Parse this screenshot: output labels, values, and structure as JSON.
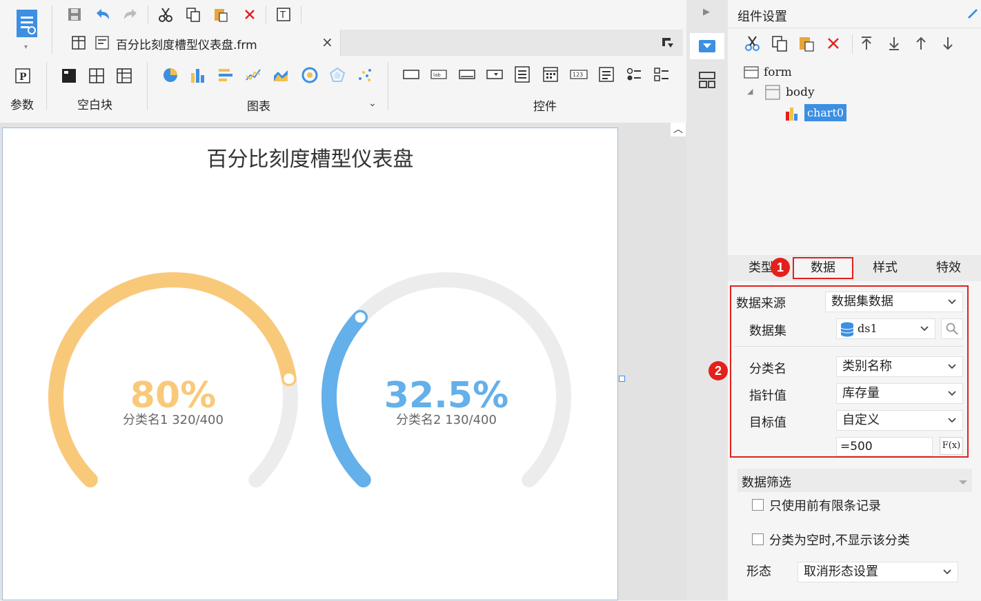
{
  "toolbar": {
    "groups": {
      "param": "参数",
      "blank": "空白块",
      "chart": "图表",
      "widget": "控件"
    }
  },
  "file_tab": {
    "title": "百分比刻度槽型仪表盘.frm",
    "close": "×"
  },
  "chart": {
    "title": "百分比刻度槽型仪表盘"
  },
  "chart_data": [
    {
      "type": "gauge",
      "category": "分类名1",
      "value": 320,
      "max": 400,
      "percent_label": "80%",
      "detail_label": "分类名1 320/400",
      "color": "#f9c97a"
    },
    {
      "type": "gauge",
      "category": "分类名2",
      "value": 130,
      "max": 400,
      "percent_label": "32.5%",
      "detail_label": "分类名2 130/400",
      "color": "#63b0ea"
    }
  ],
  "right_panel": {
    "title": "组件设置",
    "tree": {
      "form": "form",
      "body": "body",
      "chart": "chart0"
    },
    "tabs": [
      "类型",
      "数据",
      "样式",
      "特效"
    ],
    "data_source_label": "数据来源",
    "data_source_value": "数据集数据",
    "dataset_label": "数据集",
    "dataset_value": "ds1",
    "category_label": "分类名",
    "category_value": "类别名称",
    "pointer_label": "指针值",
    "pointer_value": "库存量",
    "target_label": "目标值",
    "target_value": "自定义",
    "target_formula": "=500",
    "fx": "F(x)",
    "filter_title": "数据筛选",
    "checkbox1": "只使用前有限条记录",
    "checkbox2": "分类为空时,不显示该分类",
    "form_label": "形态",
    "form_value": "取消形态设置"
  },
  "badges": [
    "1",
    "2"
  ],
  "colors": {
    "accent_red": "#e3201b",
    "selection_blue": "#3c8fe2",
    "gauge_track": "#ececec"
  }
}
